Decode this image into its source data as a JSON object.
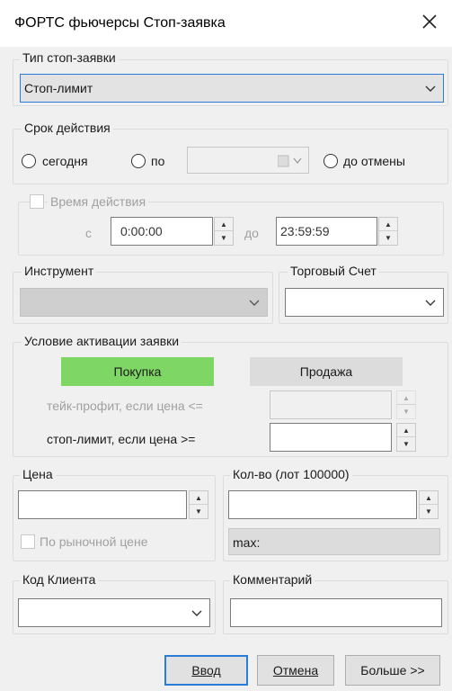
{
  "window": {
    "title": "ФОРТС фьючерсы Стоп-заявка",
    "close_icon": "close-icon"
  },
  "stop_type": {
    "legend": "Тип стоп-заявки",
    "selected": "Стоп-лимит"
  },
  "validity": {
    "legend": "Срок действия",
    "options": {
      "today": "сегодня",
      "until": "по",
      "gtc": "до отмены"
    },
    "date_value": ""
  },
  "time": {
    "legend": "Время действия",
    "from_label": "с",
    "from_value": "0:00:00",
    "to_label": "до",
    "to_value": "23:59:59"
  },
  "instrument": {
    "legend": "Инструмент",
    "value": ""
  },
  "account": {
    "legend": "Торговый Счет",
    "value": ""
  },
  "activation": {
    "legend": "Условие активации заявки",
    "buy_label": "Покупка",
    "sell_label": "Продажа",
    "take_profit_label": "тейк-профит, если цена <=",
    "stop_limit_label": "стоп-лимит, если цена >=",
    "take_profit_value": "",
    "stop_limit_value": ""
  },
  "price": {
    "legend": "Цена",
    "value": "",
    "market_label": "По рыночной цене"
  },
  "quantity": {
    "legend": "Кол-во (лот 100000)",
    "value": "",
    "max_label": "max:"
  },
  "client": {
    "legend": "Код Клиента",
    "value": ""
  },
  "comment": {
    "legend": "Комментарий",
    "value": ""
  },
  "buttons": {
    "enter": "Ввод",
    "cancel": "Отмена",
    "more": "Больше >>"
  },
  "colors": {
    "buy_active": "#7ed665",
    "focus_border": "#2b7bd8",
    "window_bg": "#f0f0f0"
  }
}
